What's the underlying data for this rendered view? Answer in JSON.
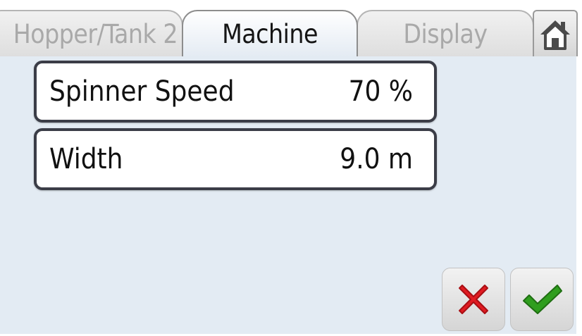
{
  "tabs": [
    {
      "label": "Hopper/Tank 2",
      "active": false
    },
    {
      "label": "Machine",
      "active": true
    },
    {
      "label": "Display",
      "active": false
    }
  ],
  "home_icon": "home-icon",
  "fields": [
    {
      "label": "Spinner Speed",
      "value": "70 %"
    },
    {
      "label": "Width",
      "value": "9.0 m"
    }
  ],
  "actions": {
    "cancel_icon": "close-icon",
    "confirm_icon": "checkmark-icon",
    "cancel_color": "#e11b22",
    "confirm_color": "#2f9e1e"
  }
}
